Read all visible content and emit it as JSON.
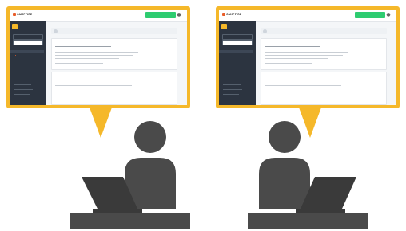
{
  "colors": {
    "bubble": "#f5b82a",
    "sidebar": "#2c3440",
    "cta": "#2ecc71",
    "figure": "#4a4a4a",
    "accent": "#e85d2a"
  },
  "panels": [
    {
      "logo": "CAMPFIRE",
      "topbar_title": "",
      "brand_text": "",
      "side_button_1": "",
      "side_button_2": "",
      "side_headings": [
        "",
        ""
      ],
      "side_items": [
        "",
        "",
        "",
        "",
        ""
      ],
      "breadcrumb": "",
      "notice_text": "",
      "cta_label": "",
      "card_1_title": "",
      "card_1_tag": "",
      "card_2_title": ""
    },
    {
      "logo": "CAMPFIRE",
      "topbar_title": "",
      "brand_text": "",
      "side_button_1": "",
      "side_button_2": "",
      "side_headings": [
        "",
        ""
      ],
      "side_items": [
        "",
        "",
        "",
        "",
        ""
      ],
      "breadcrumb": "",
      "notice_text": "",
      "cta_label": "",
      "card_1_title": "",
      "card_1_tag": "",
      "card_2_title": ""
    }
  ],
  "icons": [
    "laptop-icon",
    "person-icon",
    "bell-icon",
    "user-icon"
  ]
}
